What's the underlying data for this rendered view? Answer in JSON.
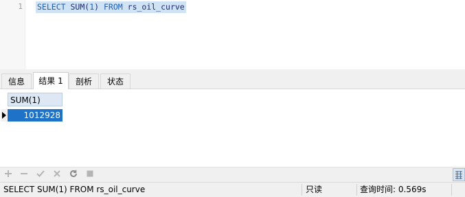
{
  "editor": {
    "line_number": "1",
    "sql": {
      "kw_select": "SELECT",
      "fn": "SUM(",
      "arg": "1",
      "close": ")",
      "kw_from": "FROM",
      "table": "rs_oil_curve"
    }
  },
  "tabs": [
    {
      "label": "信息"
    },
    {
      "label": "结果 1"
    },
    {
      "label": "剖析"
    },
    {
      "label": "状态"
    }
  ],
  "result": {
    "columns": [
      "SUM(1)"
    ],
    "rows": [
      [
        "1012928"
      ]
    ]
  },
  "toolbar": {
    "icons": [
      "add-icon",
      "delete-icon",
      "apply-icon",
      "discard-icon",
      "refresh-icon",
      "stop-icon",
      "grid-view-icon"
    ]
  },
  "status": {
    "query": "SELECT SUM(1) FROM rs_oil_curve",
    "mode": "只读",
    "time": "查询时间: 0.569s"
  },
  "colors": {
    "selection": "#cfe3f5",
    "cell_selected": "#1e73c8",
    "header": "#dde8f4"
  }
}
